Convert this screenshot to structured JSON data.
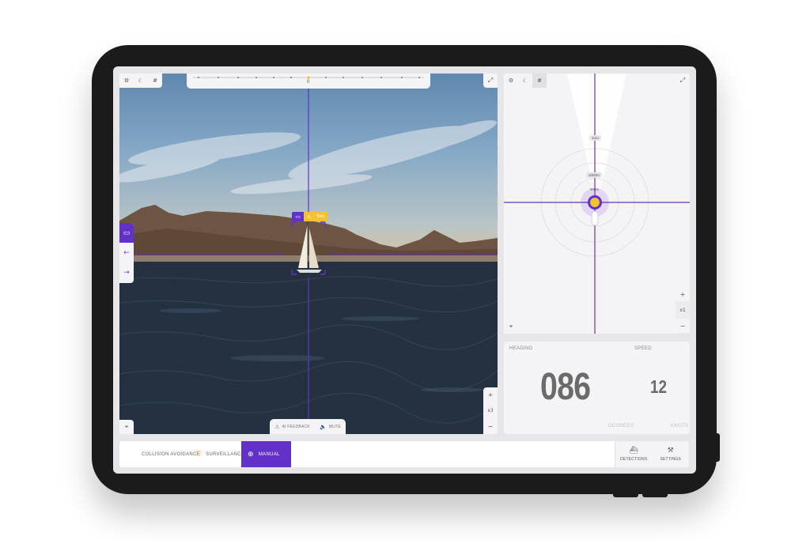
{
  "camera": {
    "compass_label": "0",
    "toolbar": [
      {
        "icon": "gear-icon",
        "glyph": "⚙"
      },
      {
        "icon": "moon-icon",
        "glyph": "☾"
      },
      {
        "icon": "grid-icon",
        "glyph": "#"
      }
    ],
    "expand_glyph": "⤢",
    "locate_glyph": "⌖",
    "side_buttons": [
      {
        "icon": "target-frame-icon",
        "glyph": "▭"
      },
      {
        "icon": "arrow-left-icon",
        "glyph": "←"
      },
      {
        "icon": "arrow-right-icon",
        "glyph": "→"
      }
    ],
    "zoom_in": "+",
    "zoom_level": "x3",
    "zoom_out": "−",
    "ai_feedback_label": "AI FEEDBACK",
    "mute_label": "MUTE",
    "target_tag": {
      "frame_glyph": "▭",
      "warning_glyph": "⚠",
      "distance": "50m"
    }
  },
  "radar": {
    "toolbar": [
      {
        "icon": "gear-icon",
        "glyph": "⚙"
      },
      {
        "icon": "moon-icon",
        "glyph": "☾"
      },
      {
        "icon": "grid-icon",
        "glyph": "#"
      }
    ],
    "expand_glyph": "⤢",
    "locate_glyph": "⌖",
    "range_labels": [
      "1nm",
      "1000m",
      "500m"
    ],
    "zoom_in": "+",
    "zoom_level": "x1",
    "zoom_out": "−"
  },
  "heading": {
    "heading_label": "HEADING",
    "speed_label": "SPEED",
    "heading_value": "086",
    "speed_value": "12",
    "heading_unit": "DEGREES",
    "speed_unit": "KNOTS"
  },
  "bottom_bar": {
    "modes": [
      {
        "label": "COLLISION AVOIDANCE"
      },
      {
        "label": "SURVEILLANCE",
        "glyph": "⛉"
      },
      {
        "label": "MANUAL",
        "glyph": "⊕"
      }
    ],
    "detections_label": "DETECTIONS",
    "detections_glyph": "⛴",
    "settings_label": "SETTINGS",
    "settings_glyph": "⚒"
  },
  "colors": {
    "accent": "#6232c8",
    "warning": "#f2c232",
    "panel": "#f4f4f6",
    "device": "#1b1b1b"
  }
}
